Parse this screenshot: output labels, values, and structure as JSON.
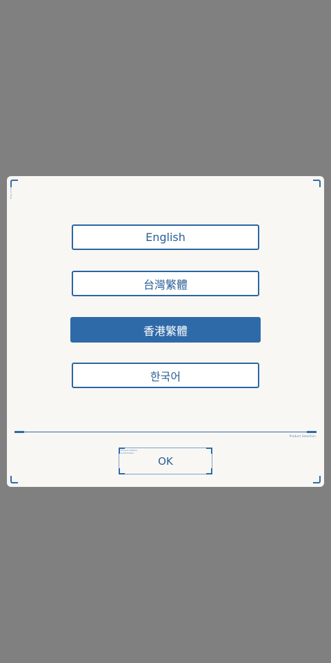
{
  "dialog": {
    "side_caption": "Product Files",
    "languages": [
      {
        "label": "English",
        "selected": false
      },
      {
        "label": "台灣繁體",
        "selected": false
      },
      {
        "label": "香港繁體",
        "selected": true
      },
      {
        "label": "한국어",
        "selected": false
      }
    ],
    "divider_caption": "Product Selection",
    "ok_caption": "Product Options Confirmation",
    "ok_label": "OK"
  },
  "colors": {
    "backdrop": "#808080",
    "dialog_bg": "#f8f7f4",
    "accent": "#2f6aa8",
    "text": "#2b5f97"
  }
}
